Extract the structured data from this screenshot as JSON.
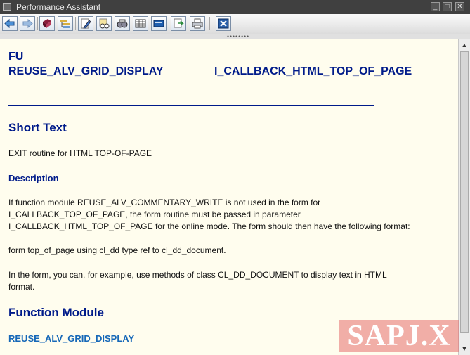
{
  "window": {
    "title": "Performance Assistant"
  },
  "toolbar": {
    "buttons": [
      {
        "name": "back-button",
        "icon": "arrow-left-icon"
      },
      {
        "name": "forward-button",
        "icon": "arrow-right-icon"
      },
      {
        "name": "bookmark-button",
        "icon": "book-icon"
      },
      {
        "name": "structure-button",
        "icon": "tree-icon"
      },
      {
        "name": "edit-button",
        "icon": "pencil-icon"
      },
      {
        "name": "display-button",
        "icon": "glasses-icon"
      },
      {
        "name": "search-button",
        "icon": "binoculars-icon"
      },
      {
        "name": "table-button",
        "icon": "grid-icon"
      },
      {
        "name": "settings-button",
        "icon": "folder-icon"
      },
      {
        "name": "export-button",
        "icon": "export-icon"
      },
      {
        "name": "print-button",
        "icon": "printer-icon"
      },
      {
        "name": "close-button",
        "icon": "close-icon"
      }
    ]
  },
  "doc": {
    "type": "FU",
    "function_name": "REUSE_ALV_GRID_DISPLAY",
    "parameter": "I_CALLBACK_HTML_TOP_OF_PAGE",
    "short_text_heading": "Short Text",
    "short_text": "EXIT routine for HTML TOP-OF-PAGE",
    "description_heading": "Description",
    "description_lines": [
      "If function module REUSE_ALV_COMMENTARY_WRITE is not used in the form for",
      "I_CALLBACK_TOP_OF_PAGE, the form routine must be passed in parameter",
      "I_CALLBACK_HTML_TOP_OF_PAGE for the online mode. The form should then have the following format:"
    ],
    "format_line": "form top_of_page using cl_dd type ref to cl_dd_document.",
    "example_lines": [
      "In the form, you can, for example, use methods of class CL_DD_DOCUMENT to display text in HTML",
      "format."
    ],
    "function_module_heading": "Function Module",
    "function_module_link": "REUSE_ALV_GRID_DISPLAY"
  },
  "watermark": {
    "text": "SAPJ.X"
  },
  "colors": {
    "heading": "#001b8a",
    "link": "#1668b8",
    "content_bg": "#fffdee"
  }
}
